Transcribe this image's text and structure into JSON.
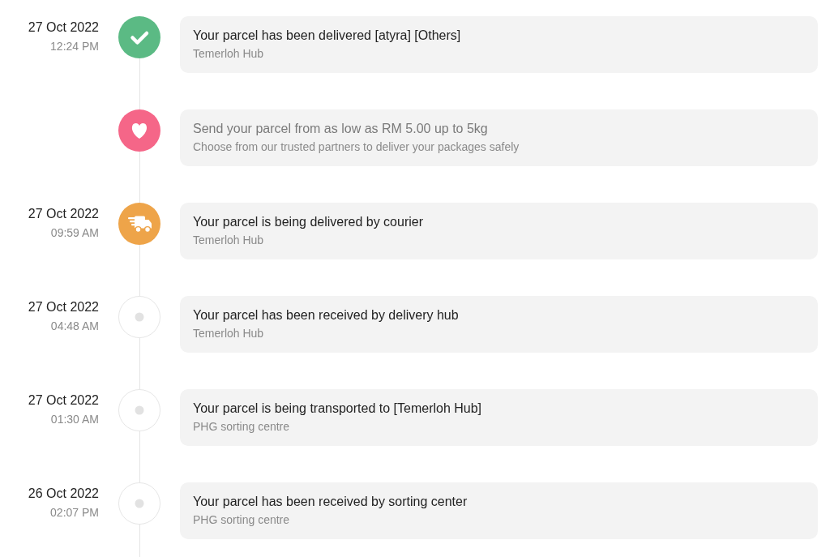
{
  "events": [
    {
      "kind": "delivered",
      "date": "27 Oct 2022",
      "time": "12:24 PM",
      "title": "Your parcel has been delivered [atyra] [Others]",
      "detail": "Temerloh Hub"
    },
    {
      "kind": "promo",
      "title": "Send your parcel from as low as RM 5.00 up to 5kg",
      "detail": "Choose from our trusted partners to deliver your packages safely"
    },
    {
      "kind": "courier",
      "date": "27 Oct 2022",
      "time": "09:59 AM",
      "title": "Your parcel is being delivered by courier",
      "detail": "Temerloh Hub"
    },
    {
      "kind": "pending",
      "date": "27 Oct 2022",
      "time": "04:48 AM",
      "title": "Your parcel has been received by delivery hub",
      "detail": "Temerloh Hub"
    },
    {
      "kind": "pending",
      "date": "27 Oct 2022",
      "time": "01:30 AM",
      "title": "Your parcel is being transported to [Temerloh Hub]",
      "detail": "PHG sorting centre"
    },
    {
      "kind": "pending",
      "date": "26 Oct 2022",
      "time": "02:07 PM",
      "title": "Your parcel has been received by sorting center",
      "detail": "PHG sorting centre"
    }
  ]
}
